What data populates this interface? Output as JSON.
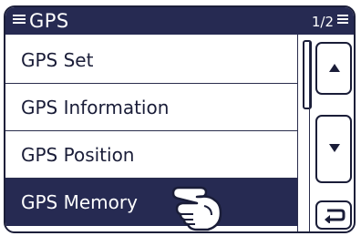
{
  "header": {
    "title": "GPS",
    "page_indicator": "1/2"
  },
  "menu": {
    "items": [
      {
        "label": "GPS Set",
        "selected": false
      },
      {
        "label": "GPS Information",
        "selected": false
      },
      {
        "label": "GPS Position",
        "selected": false
      },
      {
        "label": "GPS Memory",
        "selected": true
      }
    ]
  },
  "controls": {
    "up_icon": "up-arrow-icon",
    "down_icon": "down-arrow-icon",
    "back_icon": "return-icon"
  },
  "colors": {
    "title_bar": "#262a52",
    "selected_row": "#262a52",
    "text": "#1a1d38",
    "background": "#ffffff"
  }
}
